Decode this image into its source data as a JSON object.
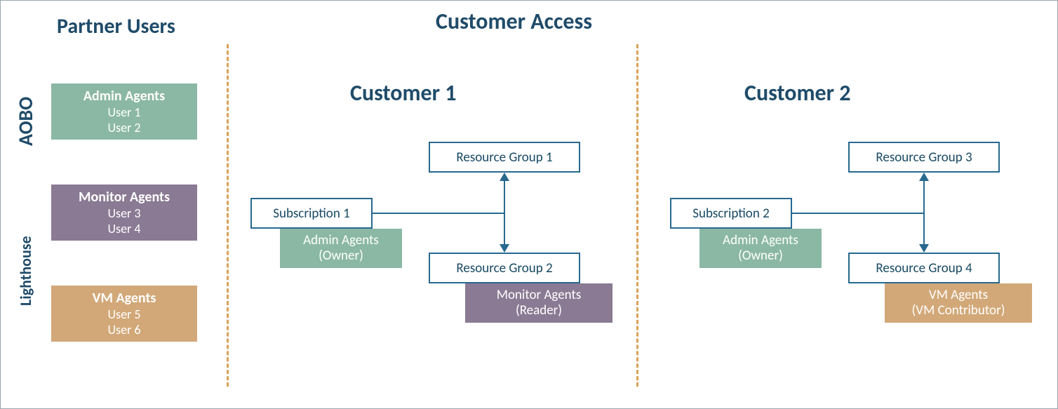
{
  "headers": {
    "partner_users": "Partner Users",
    "customer_access": "Customer Access",
    "customer1": "Customer 1",
    "customer2": "Customer 2"
  },
  "side_labels": {
    "aobo": "AOBO",
    "lighthouse": "Lighthouse"
  },
  "groups": {
    "admin": {
      "title": "Admin Agents",
      "user_a": "User 1",
      "user_b": "User 2",
      "color": "#8bb8a4"
    },
    "monitor": {
      "title": "Monitor Agents",
      "user_a": "User 3",
      "user_b": "User 4",
      "color": "#8a7a93"
    },
    "vm": {
      "title": "VM Agents",
      "user_a": "User 5",
      "user_b": "User 6",
      "color": "#d2a878"
    }
  },
  "customer1": {
    "subscription": {
      "label": "Subscription 1",
      "tag_title": "Admin Agents",
      "tag_role": "(Owner)",
      "tag_color": "#8bb8a4"
    },
    "rg_top": {
      "label": "Resource Group 1"
    },
    "rg_bottom": {
      "label": "Resource Group 2",
      "tag_title": "Monitor Agents",
      "tag_role": "(Reader)",
      "tag_color": "#8a7a93"
    }
  },
  "customer2": {
    "subscription": {
      "label": "Subscription 2",
      "tag_title": "Admin Agents",
      "tag_role": "(Owner)",
      "tag_color": "#8bb8a4"
    },
    "rg_top": {
      "label": "Resource Group 3"
    },
    "rg_bottom": {
      "label": "Resource Group 4",
      "tag_title": "VM Agents",
      "tag_role": "(VM Contributor)",
      "tag_color": "#d2a878"
    }
  }
}
